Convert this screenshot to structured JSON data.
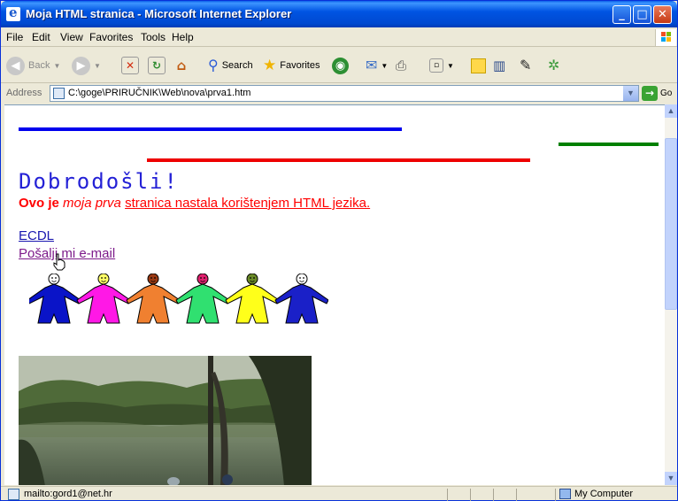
{
  "window": {
    "title": "Moja HTML stranica - Microsoft Internet Explorer",
    "minimize_glyph": "_",
    "maximize_glyph": "□",
    "close_glyph": "✕"
  },
  "menu": [
    "File",
    "Edit",
    "View",
    "Favorites",
    "Tools",
    "Help"
  ],
  "toolbar": {
    "back_label": "Back",
    "search_label": "Search",
    "favorites_label": "Favorites"
  },
  "address": {
    "label": "Address",
    "url": "C:\\goge\\PRIRUČNIK\\Web\\nova\\prva1.htm",
    "go_label": "Go"
  },
  "page": {
    "heading": "Dobrodošli!",
    "intro_bold": "Ovo je",
    "intro_italic": "moja prva",
    "intro_underlined": "stranica nastala korištenjem HTML jezika.",
    "link_ecdl": "ECDL",
    "link_email": "Pošalji mi e-mail",
    "colors": {
      "heading": "#2421d6",
      "intro": "#ff0000",
      "link": "#1a18b0",
      "visited_link": "#7d1a8a",
      "line_blue": "#0000ee",
      "line_red": "#ee0000",
      "line_green": "#008000"
    },
    "figures": [
      {
        "body": "#0a14c8",
        "face": "#ffffff"
      },
      {
        "body": "#ff18e6",
        "face": "#ffff66"
      },
      {
        "body": "#f08030",
        "face": "#9a3a14"
      },
      {
        "body": "#30e070",
        "face": "#e0206e"
      },
      {
        "body": "#ffff1a",
        "face": "#6a8a28"
      },
      {
        "body": "#1a20c8",
        "face": "#ffffff"
      }
    ]
  },
  "status": {
    "text": "mailto:gord1@net.hr",
    "zone": "My Computer"
  }
}
